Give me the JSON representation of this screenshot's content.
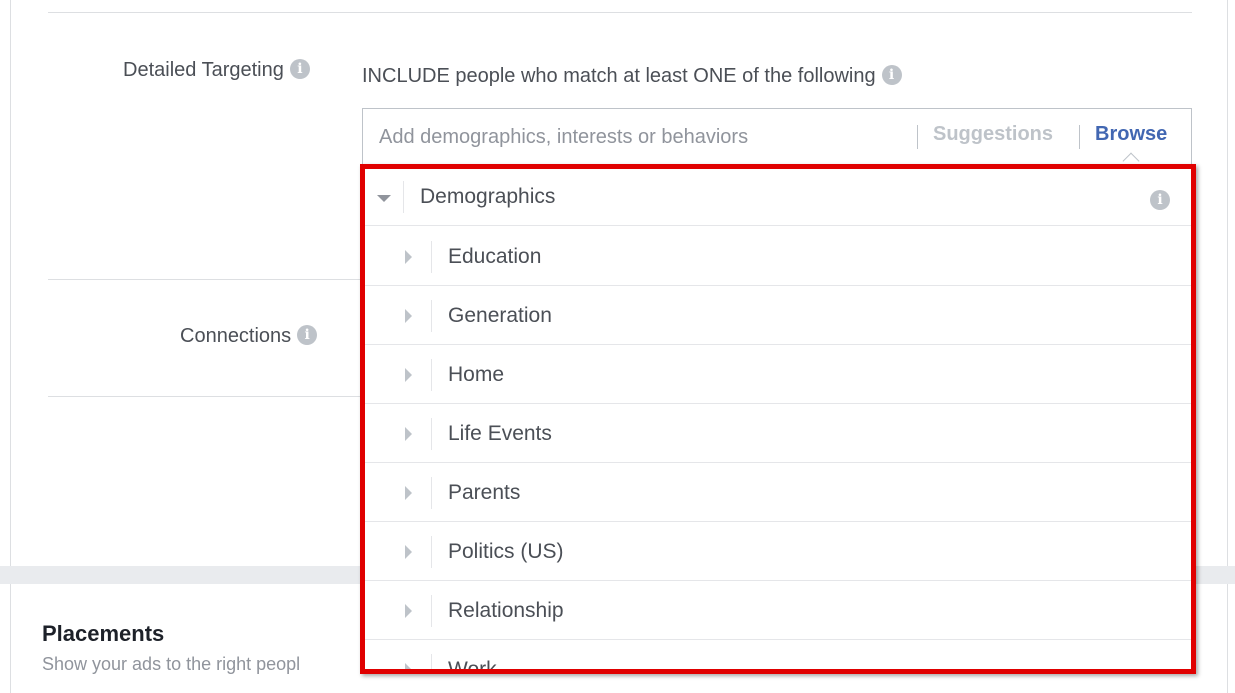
{
  "detailed_targeting": {
    "label": "Detailed Targeting",
    "include_text": "INCLUDE people who match at least ONE of the following",
    "search": {
      "placeholder": "Add demographics, interests or behaviors",
      "value": "",
      "suggestions_label": "Suggestions",
      "browse_label": "Browse"
    }
  },
  "connections": {
    "label": "Connections"
  },
  "dropdown": {
    "category": "Demographics",
    "items": [
      {
        "label": "Education"
      },
      {
        "label": "Generation"
      },
      {
        "label": "Home"
      },
      {
        "label": "Life Events"
      },
      {
        "label": "Parents"
      },
      {
        "label": "Politics (US)"
      },
      {
        "label": "Relationship"
      },
      {
        "label": "Work"
      }
    ]
  },
  "placements": {
    "title": "Placements",
    "subtitle": "Show your ads to the right peopl"
  },
  "icons": {
    "info": "info-icon",
    "expand": "triangle-down-icon",
    "collapsed": "triangle-right-icon"
  },
  "colors": {
    "link_blue": "#4267b2",
    "highlight_red": "#e00000",
    "text_gray": "#4b4f56",
    "muted_gray": "#90949c"
  }
}
